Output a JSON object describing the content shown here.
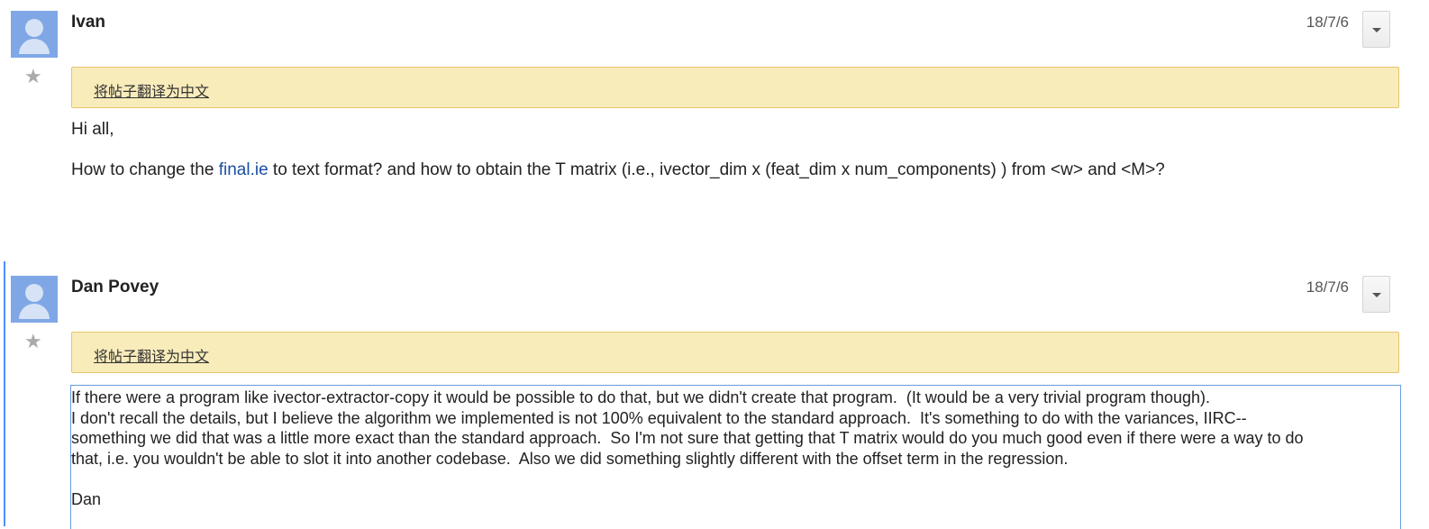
{
  "posts": [
    {
      "author": "Ivan",
      "date": "18/7/6",
      "translate_link": "将帖子翻译为中文",
      "greeting": "Hi all,",
      "body_before_link": "How to change the ",
      "body_link": "final.ie",
      "body_after_link": " to text format? and how to obtain the T matrix (i.e., ivector_dim x (feat_dim x num_components) ) from <w> and <M>?"
    },
    {
      "author": "Dan Povey",
      "date": "18/7/6",
      "translate_link": "将帖子翻译为中文",
      "body": "If there were a program like ivector-extractor-copy it would be possible to do that, but we didn't create that program.  (It would be a very trivial program though).\nI don't recall the details, but I believe the algorithm we implemented is not 100% equivalent to the standard approach.  It's something to do with the variances, IIRC--\nsomething we did that was a little more exact than the standard approach.  So I'm not sure that getting that T matrix would do you much good even if there were a way to do\nthat, i.e. you wouldn't be able to slot it into another codebase.  Also we did something slightly different with the offset term in the regression.\n\nDan"
    }
  ],
  "icons": {
    "star": "star-icon",
    "avatar": "default-avatar-icon",
    "menu": "chevron-down-icon"
  },
  "colors": {
    "translate_bar_bg": "#f9ecbb",
    "translate_bar_border": "#e8c46c",
    "link": "#1a4ea3",
    "avatar": "#7fa7e6",
    "selection_border": "#4d90fe"
  }
}
